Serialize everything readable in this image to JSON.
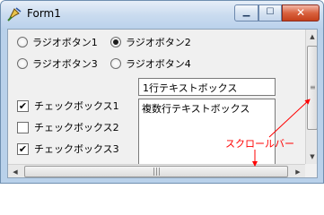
{
  "window": {
    "title": "Form1",
    "controls": {
      "minimize": "▁",
      "maximize": "☐",
      "close": "✕"
    }
  },
  "radios": [
    {
      "label": "ラジオボタン1",
      "checked": false
    },
    {
      "label": "ラジオボタン2",
      "checked": true
    },
    {
      "label": "ラジオボタン3",
      "checked": false
    },
    {
      "label": "ラジオボタン4",
      "checked": false
    }
  ],
  "checkboxes": [
    {
      "label": "チェックボックス1",
      "checked": true
    },
    {
      "label": "チェックボックス2",
      "checked": false
    },
    {
      "label": "チェックボックス3",
      "checked": true
    }
  ],
  "textboxes": {
    "single_line": "1行テキストボックス",
    "multi_line": "複数行テキストボックス"
  },
  "annotation": {
    "text": "スクロールバー",
    "color": "#ff0000"
  },
  "icons": [
    "app-icon",
    "minimize-icon",
    "maximize-icon",
    "close-icon",
    "scroll-up-arrow-icon",
    "scroll-down-arrow-icon",
    "scroll-left-arrow-icon",
    "scroll-right-arrow-icon",
    "grip-icon"
  ]
}
